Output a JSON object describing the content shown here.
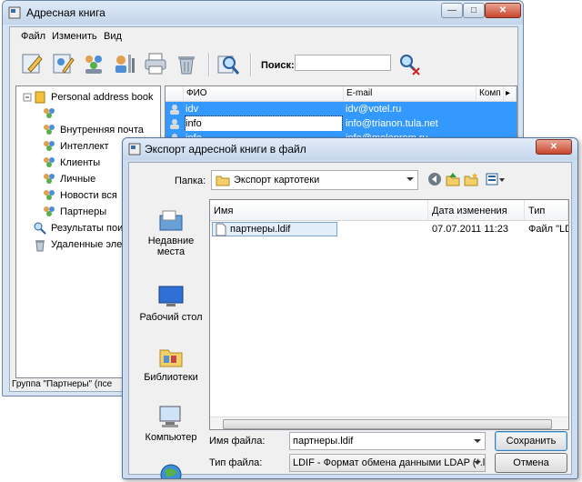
{
  "main_window": {
    "title": "Адресная книга",
    "controls": {
      "minimize": "—",
      "maximize": "□",
      "close": "✕"
    },
    "menu": [
      "Файл",
      "Изменить",
      "Вид"
    ],
    "search": {
      "label": "Поиск:",
      "value": ""
    },
    "tree": {
      "root": "Personal address book",
      "items": [
        "",
        "Внутренняя почта",
        "Интеллект",
        "Клиенты",
        "Личные",
        "Новости вся",
        "Партнеры"
      ],
      "extra": [
        "Результаты пои",
        "Удаленные элем"
      ]
    },
    "grid": {
      "columns": [
        "ФИО",
        "E-mail",
        "Комп"
      ],
      "rows": [
        {
          "name": "idv",
          "email": "idv@votel.ru"
        },
        {
          "name": "info",
          "email": "info@trianon.tula.net"
        },
        {
          "name": "info",
          "email": "info@moloprom.ru"
        }
      ]
    },
    "status": "Группа \"Партнеры\" (псе"
  },
  "dialog": {
    "title": "Экспорт адресной книги в файл",
    "close": "✕",
    "folder_label": "Папка:",
    "folder_value": "Экспорт картотеки",
    "places": [
      "Недавние места",
      "Рабочий стол",
      "Библиотеки",
      "Компьютер"
    ],
    "columns": [
      "Имя",
      "Дата изменения",
      "Тип"
    ],
    "files": [
      {
        "name": "партнеры.ldif",
        "date": "07.07.2011 11:23",
        "type": "Файл \"LDI"
      }
    ],
    "filename_label": "Имя файла:",
    "filename_value": "партнеры.ldif",
    "filetype_label": "Тип файла:",
    "filetype_value": "LDIF - Формат обмена данными LDAP (*.ldif,",
    "save_label": "Сохранить",
    "cancel_label": "Отмена"
  },
  "colors": {
    "selection": "#3399ff",
    "accent": "#c8452c"
  }
}
